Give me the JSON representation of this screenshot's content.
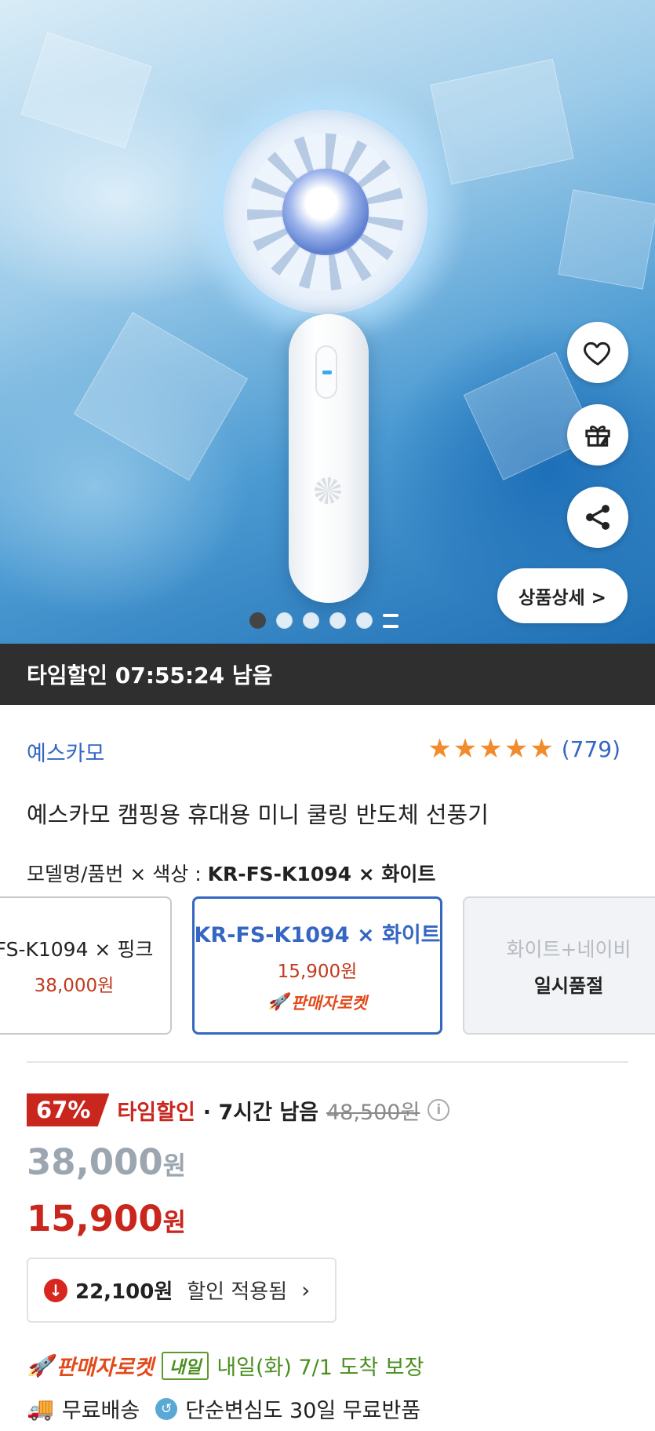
{
  "hero": {
    "detail_button_label": "상품상세 >",
    "page_dots_count": 5,
    "active_dot_index": 0
  },
  "timer": {
    "text": "타임할인 07:55:24 남음"
  },
  "product": {
    "brand": "예스카모",
    "rating_count": "(779)",
    "rating_stars": 5,
    "title": "예스카모 캠핑용 휴대용 미니 쿨링 반도체 선풍기",
    "option_label": "모델명/품번 × 색상 : ",
    "option_value": "KR-FS-K1094 × 화이트"
  },
  "options": [
    {
      "name": "FS-K1094 × 핑크",
      "price": "38,000원"
    },
    {
      "name": "KR-FS-K1094 × 화이트",
      "price": "15,900원",
      "badge": "판매자로켓"
    },
    {
      "name": "화이트+네이비",
      "status": "일시품절"
    }
  ],
  "pricing": {
    "discount_pct": "67%",
    "sale_name": "타임할인",
    "sale_remaining": "· 7시간 남음",
    "original_price": "48,500원",
    "was_price": "38,000",
    "now_price": "15,900",
    "currency": "원",
    "discount_amount": "22,100원",
    "discount_text": "할인 적용됨"
  },
  "delivery": {
    "rocket_label": "판매자로켓",
    "tomorrow_badge": "내일",
    "arrival_text": "내일(화) 7/1 도착 보장",
    "free_shipping": "무료배송",
    "return_text": "단순변심도 30일 무료반품"
  },
  "colors": {
    "accent_blue": "#3466c2",
    "sale_red": "#c9261d",
    "rocket_orange": "#e34a1b",
    "delivery_green": "#4a8f1f"
  }
}
